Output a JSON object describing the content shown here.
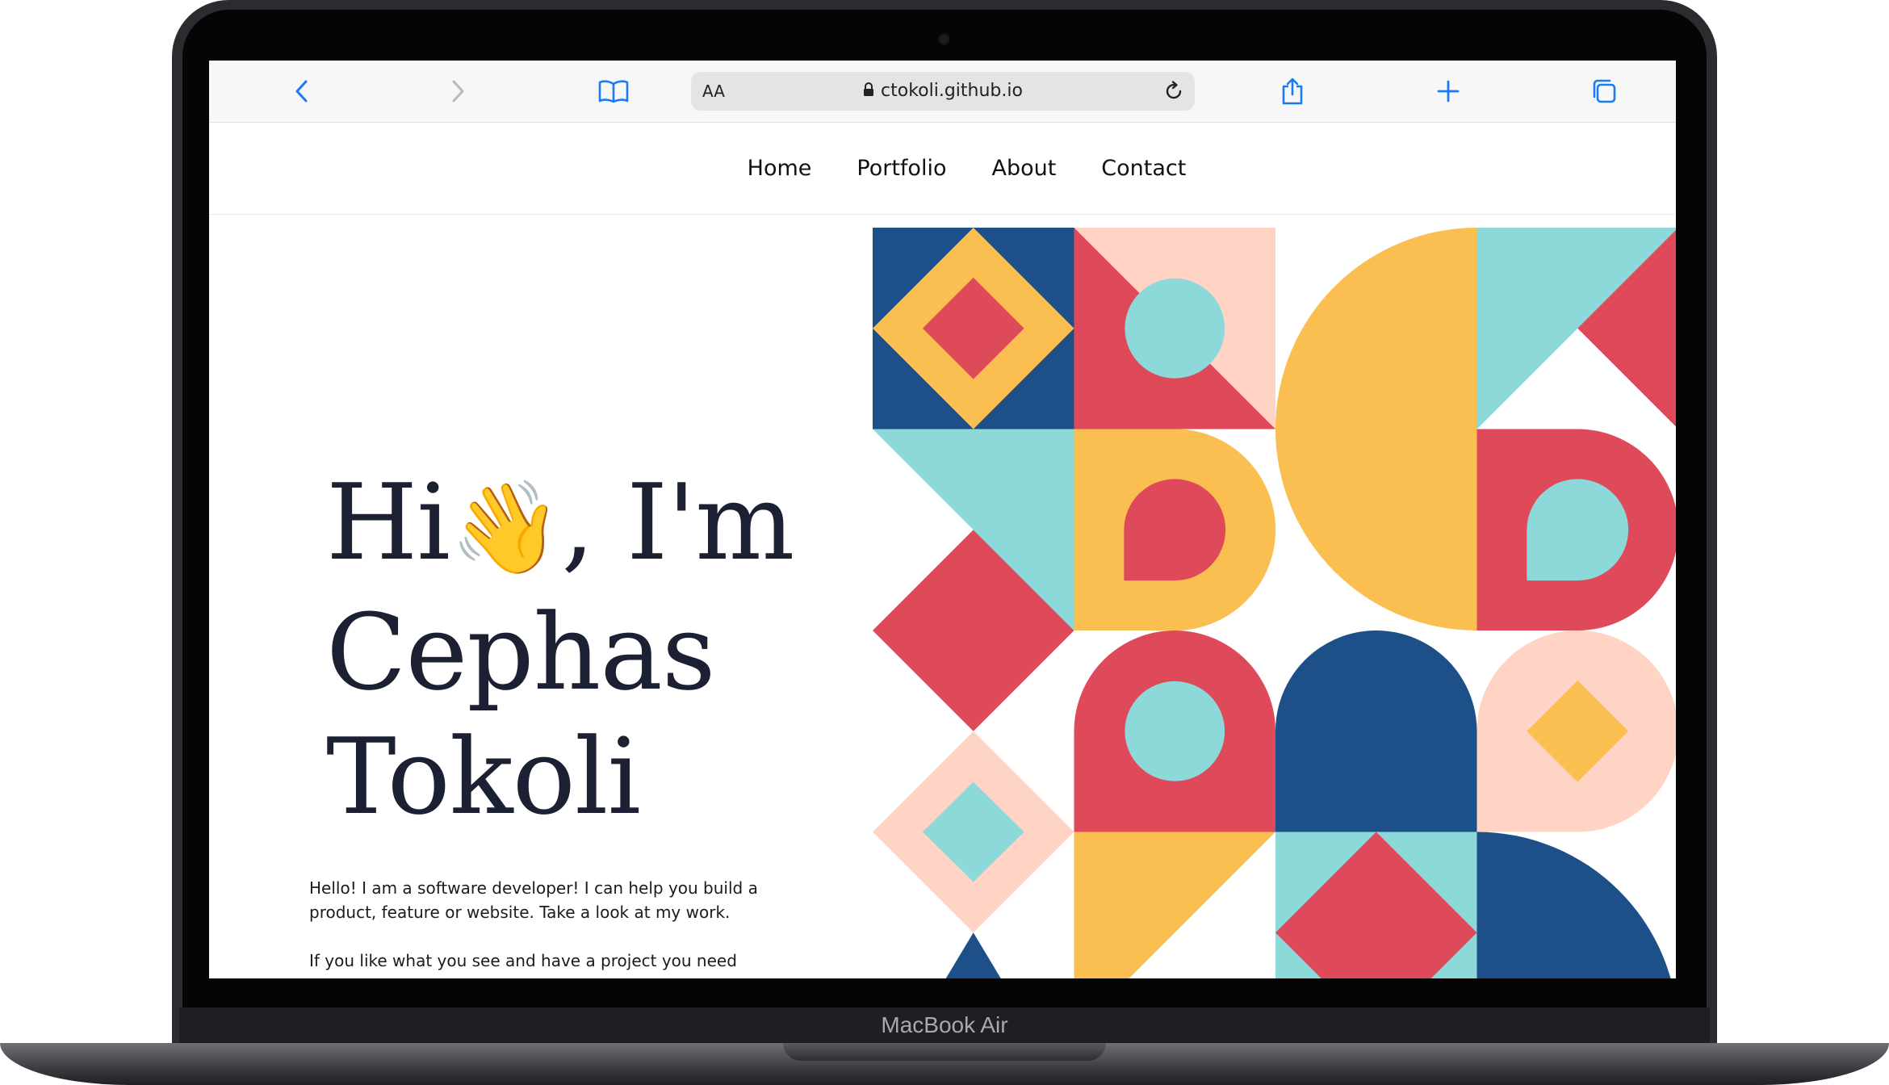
{
  "browser": {
    "aa_label": "AA",
    "url": "ctokoli.github.io",
    "icons": [
      "back-icon",
      "forward-icon",
      "bookmarks-icon",
      "lock-icon",
      "reload-icon",
      "share-icon",
      "plus-icon",
      "tabs-icon"
    ]
  },
  "nav": {
    "items": [
      "Home",
      "Portfolio",
      "About",
      "Contact"
    ]
  },
  "hero": {
    "line1_a": "Hi",
    "wave_emoji": "👋",
    "line1_b": ", I'm",
    "line2": "Cephas",
    "line3": "Tokoli",
    "paragraph1": "Hello! I am a software developer! I can help you build a product, feature or website. Take a look at my work.",
    "paragraph2": "If you like what you see and have a project you need"
  },
  "device": {
    "model": "MacBook Air"
  },
  "colors": {
    "navy": "#1d4f88",
    "red": "#df4a5a",
    "yellow": "#fbbe50",
    "teal": "#8dd9da",
    "peach": "#ffd4c4",
    "accent_blue": "#1a7cf4"
  }
}
